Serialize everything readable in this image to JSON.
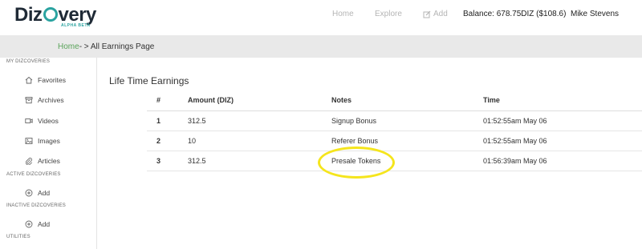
{
  "header": {
    "logo_text_left": "Diz",
    "logo_text_right": "very",
    "logo_tag": "ALPHA BETA",
    "nav": {
      "home": "Home",
      "explore": "Explore",
      "add": "Add"
    },
    "balance": "Balance: 678.75DIZ ($108.6)",
    "user": "Mike Stevens"
  },
  "breadcrumb": {
    "home": "Home",
    "separator": "- > ",
    "current": "All Earnings Page"
  },
  "sidebar": {
    "my_title": "MY DIZCOVERIES",
    "my_items": [
      {
        "label": "Favorites",
        "icon": "home-icon"
      },
      {
        "label": "Archives",
        "icon": "archive-icon"
      },
      {
        "label": "Videos",
        "icon": "video-icon"
      },
      {
        "label": "Images",
        "icon": "image-icon"
      },
      {
        "label": "Articles",
        "icon": "paperclip-icon"
      }
    ],
    "active_title": "ACTIVE DIZCOVERIES",
    "active_add": "Add",
    "inactive_title": "INACTIVE DIZCOVERIES",
    "inactive_add": "Add",
    "utilities_title": "UTILITIES"
  },
  "main": {
    "title": "Life Time Earnings",
    "columns": [
      "#",
      "Amount (DIZ)",
      "Notes",
      "Time"
    ],
    "rows": [
      {
        "num": "1",
        "amount": "312.5",
        "notes": "Signup Bonus",
        "time": "01:52:55am May 06"
      },
      {
        "num": "2",
        "amount": "10",
        "notes": "Referer Bonus",
        "time": "01:52:55am May 06"
      },
      {
        "num": "3",
        "amount": "312.5",
        "notes": "Presale Tokens",
        "time": "01:56:39am May 06"
      }
    ]
  },
  "colors": {
    "accent": "#2aa3a0",
    "breadcrumb_link": "#5aa35a",
    "highlight": "#f5e51c"
  }
}
